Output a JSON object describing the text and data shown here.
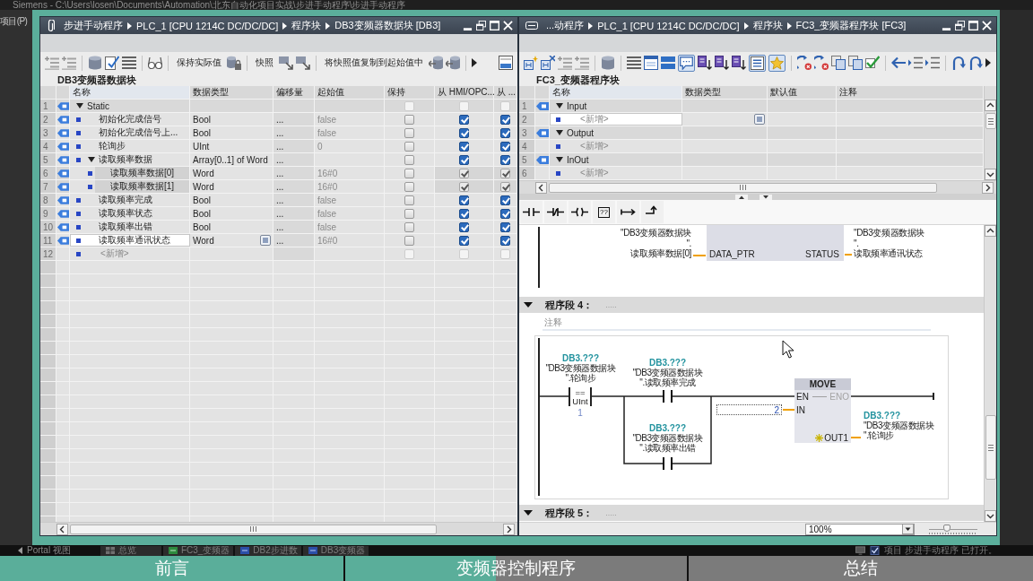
{
  "app_title": "Siemens - C:\\Users\\losen\\Documents\\Automation\\北东自动化项目实战\\步进手动程序\\步进手动程序",
  "app_menu": [
    "项目(P)"
  ],
  "db_editor": {
    "breadcrumb": [
      "步进手动程序",
      "PLC_1 [CPU 1214C DC/DC/DC]",
      "程序块",
      "DB3变频器数据块 [DB3]"
    ],
    "toolbar_buttons": [
      "保持实际值",
      "快照",
      "将快照值复制到起始值中"
    ],
    "block_title": "DB3变频器数据块",
    "columns": [
      "名称",
      "数据类型",
      "偏移量",
      "起始值",
      "保持",
      "从 HMI/OPC...",
      "从 ..."
    ],
    "rows": [
      {
        "line": "1",
        "kind": "section",
        "name": "Static",
        "expanded": true,
        "selected": false,
        "checks": [
          {
            "checked": false,
            "disabled": true
          },
          {
            "checked": false,
            "disabled": true
          },
          {
            "checked": false,
            "disabled": true
          }
        ],
        "children": [
          {
            "line": "2",
            "kind": "variable",
            "name": "初始化完成信号",
            "type": "Bool",
            "offset": "...",
            "start": "false",
            "selected": false,
            "checks": [
              {
                "checked": false,
                "disabled": false
              },
              {
                "checked": true,
                "disabled": false
              },
              {
                "checked": true,
                "disabled": false
              }
            ]
          },
          {
            "line": "3",
            "kind": "variable",
            "name": "初始化完成信号上...",
            "type": "Bool",
            "offset": "...",
            "start": "false",
            "selected": false,
            "checks": [
              {
                "checked": false,
                "disabled": false
              },
              {
                "checked": true,
                "disabled": false
              },
              {
                "checked": true,
                "disabled": false
              }
            ]
          },
          {
            "line": "4",
            "kind": "variable",
            "name": "轮询步",
            "type": "UInt",
            "offset": "...",
            "start": "0",
            "selected": false,
            "checks": [
              {
                "checked": false,
                "disabled": false
              },
              {
                "checked": true,
                "disabled": false
              },
              {
                "checked": true,
                "disabled": false
              }
            ]
          },
          {
            "line": "5",
            "kind": "variable",
            "name": "读取频率数据",
            "type": "Array[0..1] of Word",
            "offset": "...",
            "expanded": true,
            "selected": false,
            "checks": [
              {
                "checked": false,
                "disabled": false
              },
              {
                "checked": true,
                "disabled": false
              },
              {
                "checked": true,
                "disabled": false
              }
            ],
            "children": [
              {
                "line": "6",
                "kind": "variable",
                "name": "读取频率数据[0]",
                "type": "Word",
                "offset": "...",
                "start": "16#0",
                "selected": false,
                "checks": [
                  {
                    "checked": false,
                    "disabled": false
                  },
                  {
                    "checked": true,
                    "disabled": true
                  },
                  {
                    "checked": true,
                    "disabled": true
                  }
                ]
              },
              {
                "line": "7",
                "kind": "variable",
                "name": "读取频率数据[1]",
                "type": "Word",
                "offset": "...",
                "start": "16#0",
                "selected": false,
                "checks": [
                  {
                    "checked": false,
                    "disabled": false
                  },
                  {
                    "checked": true,
                    "disabled": true
                  },
                  {
                    "checked": true,
                    "disabled": true
                  }
                ]
              }
            ]
          },
          {
            "line": "8",
            "kind": "variable",
            "name": "读取频率完成",
            "type": "Bool",
            "offset": "...",
            "start": "false",
            "selected": false,
            "checks": [
              {
                "checked": false,
                "disabled": false
              },
              {
                "checked": true,
                "disabled": false
              },
              {
                "checked": true,
                "disabled": false
              }
            ]
          },
          {
            "line": "9",
            "kind": "variable",
            "name": "读取频率状态",
            "type": "Bool",
            "offset": "...",
            "start": "false",
            "selected": false,
            "checks": [
              {
                "checked": false,
                "disabled": false
              },
              {
                "checked": true,
                "disabled": false
              },
              {
                "checked": true,
                "disabled": false
              }
            ]
          },
          {
            "line": "10",
            "kind": "variable",
            "name": "读取频率出错",
            "type": "Bool",
            "offset": "...",
            "start": "false",
            "selected": false,
            "checks": [
              {
                "checked": false,
                "disabled": false
              },
              {
                "checked": true,
                "disabled": false
              },
              {
                "checked": true,
                "disabled": false
              }
            ]
          },
          {
            "line": "11",
            "kind": "variable",
            "name": "读取频率通讯状态",
            "type": "Word",
            "offset": "...",
            "start": "16#0",
            "selected": true,
            "checks": [
              {
                "checked": false,
                "disabled": false
              },
              {
                "checked": true,
                "disabled": false
              },
              {
                "checked": true,
                "disabled": false
              }
            ]
          },
          {
            "line": "12",
            "kind": "add",
            "name": "<新增>",
            "selected": false,
            "checks": [
              {
                "checked": false,
                "disabled": true
              },
              {
                "checked": false,
                "disabled": true
              },
              {
                "checked": false,
                "disabled": true
              }
            ]
          }
        ]
      }
    ]
  },
  "fc_editor": {
    "breadcrumb": [
      "...动程序",
      "PLC_1 [CPU 1214C DC/DC/DC]",
      "程序块",
      "FC3_变频器程序块 [FC3]"
    ],
    "toolbar_toggles": [
      {
        "on": true
      },
      {
        "on": true
      },
      {
        "on": true
      }
    ],
    "block_title": "FC3_变频器程序块",
    "columns": [
      "名称",
      "数据类型",
      "默认值",
      "注释"
    ],
    "rows": [
      {
        "line": "1",
        "kind": "section",
        "name": "Input",
        "expanded": true,
        "selected": false,
        "children": [
          {
            "line": "2",
            "kind": "add",
            "name": "<新增>",
            "selected": true
          }
        ]
      },
      {
        "line": "3",
        "kind": "section",
        "name": "Output",
        "expanded": true,
        "selected": false,
        "children": [
          {
            "line": "4",
            "kind": "add",
            "name": "<新增>",
            "selected": false
          }
        ]
      },
      {
        "line": "5",
        "kind": "section",
        "name": "InOut",
        "expanded": true,
        "selected": false,
        "children": [
          {
            "line": "6",
            "kind": "add",
            "name": "<新增>",
            "selected": false
          }
        ]
      }
    ]
  },
  "ladder": {
    "palette_box_label": "??",
    "box": {
      "input_pin": "DATA_PTR",
      "input_operand": "\"DB3变频器数据块\n\".\n读取频率数据[0]",
      "output_pin": "STATUS",
      "output_operand": "\"DB3变频器数据块\n\".\n读取频率通讯状态"
    },
    "networks": [
      {
        "title": "程序段 4：",
        "title_hint": ".....",
        "expanded": true,
        "comment_placeholder": "注释"
      },
      {
        "title": "程序段 5：",
        "title_hint": ".....",
        "expanded": true
      }
    ],
    "compare": {
      "address": "DB3.???",
      "operand": "\"DB3变频器数据块\n\".轮询步",
      "operator": "==",
      "type": "UInt",
      "value": "1"
    },
    "contacts": [
      {
        "address": "DB3.???",
        "operand": "\"DB3变频器数据块\n\".读取频率完成"
      },
      {
        "address": "DB3.???",
        "operand": "\"DB3变频器数据块\n\".读取频率出错"
      }
    ],
    "move": {
      "name": "MOVE",
      "en": "EN",
      "eno": "ENO",
      "in": "IN",
      "in_value": "2",
      "out": "OUT1",
      "out_address": "DB3.???",
      "out_operand": "\"DB3变频器数据块\n\".轮询步"
    }
  },
  "zoom": {
    "value": "100%",
    "level": 0.37
  },
  "taskbar": {
    "portal_view": "Portal 视图",
    "tabs": [
      {
        "kind": "overview",
        "label": "总览"
      },
      {
        "kind": "function",
        "label": "FC3_变频器"
      },
      {
        "kind": "data_block",
        "label": "DB2步进数"
      },
      {
        "kind": "data_block",
        "label": "DB3变频器"
      }
    ],
    "status": "项目 步进手动程序 已打开。"
  },
  "chapter_bar": {
    "level": 0.48,
    "chapters": [
      "前言",
      "变频器控制程序",
      "总结"
    ]
  }
}
